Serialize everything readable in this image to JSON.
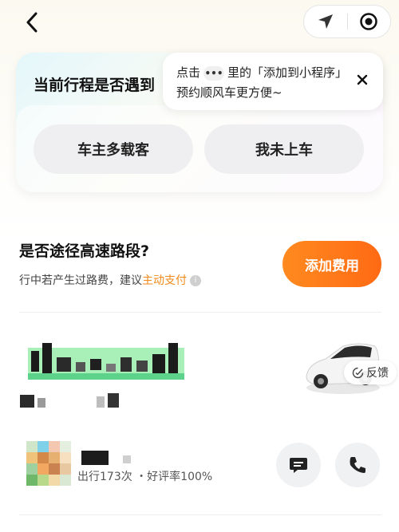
{
  "nav": {
    "back_icon": "chevron-left-icon",
    "location_icon": "location-arrow-icon",
    "target_icon": "target-circle-icon"
  },
  "trip_card": {
    "title": "当前行程是否遇到",
    "option1": "车主多载客",
    "option2": "我未上车"
  },
  "tooltip": {
    "prefix": "点击",
    "dots": "•••",
    "suffix": "里的「添加到小程序」",
    "line2": "预约顺风车更方便~",
    "close_icon": "close-icon"
  },
  "highway": {
    "title": "是否途径高速路段?",
    "sub_prefix": "行中若产生过路费，建议",
    "sub_link": "主动支付",
    "info": "i",
    "button": "添加费用"
  },
  "vehicle": {
    "feedback": "反馈"
  },
  "driver": {
    "stats": "出行173次 ・好评率100%"
  },
  "colors": {
    "accent_orange": "#ff7a1a",
    "link_orange": "#f08a1a"
  }
}
